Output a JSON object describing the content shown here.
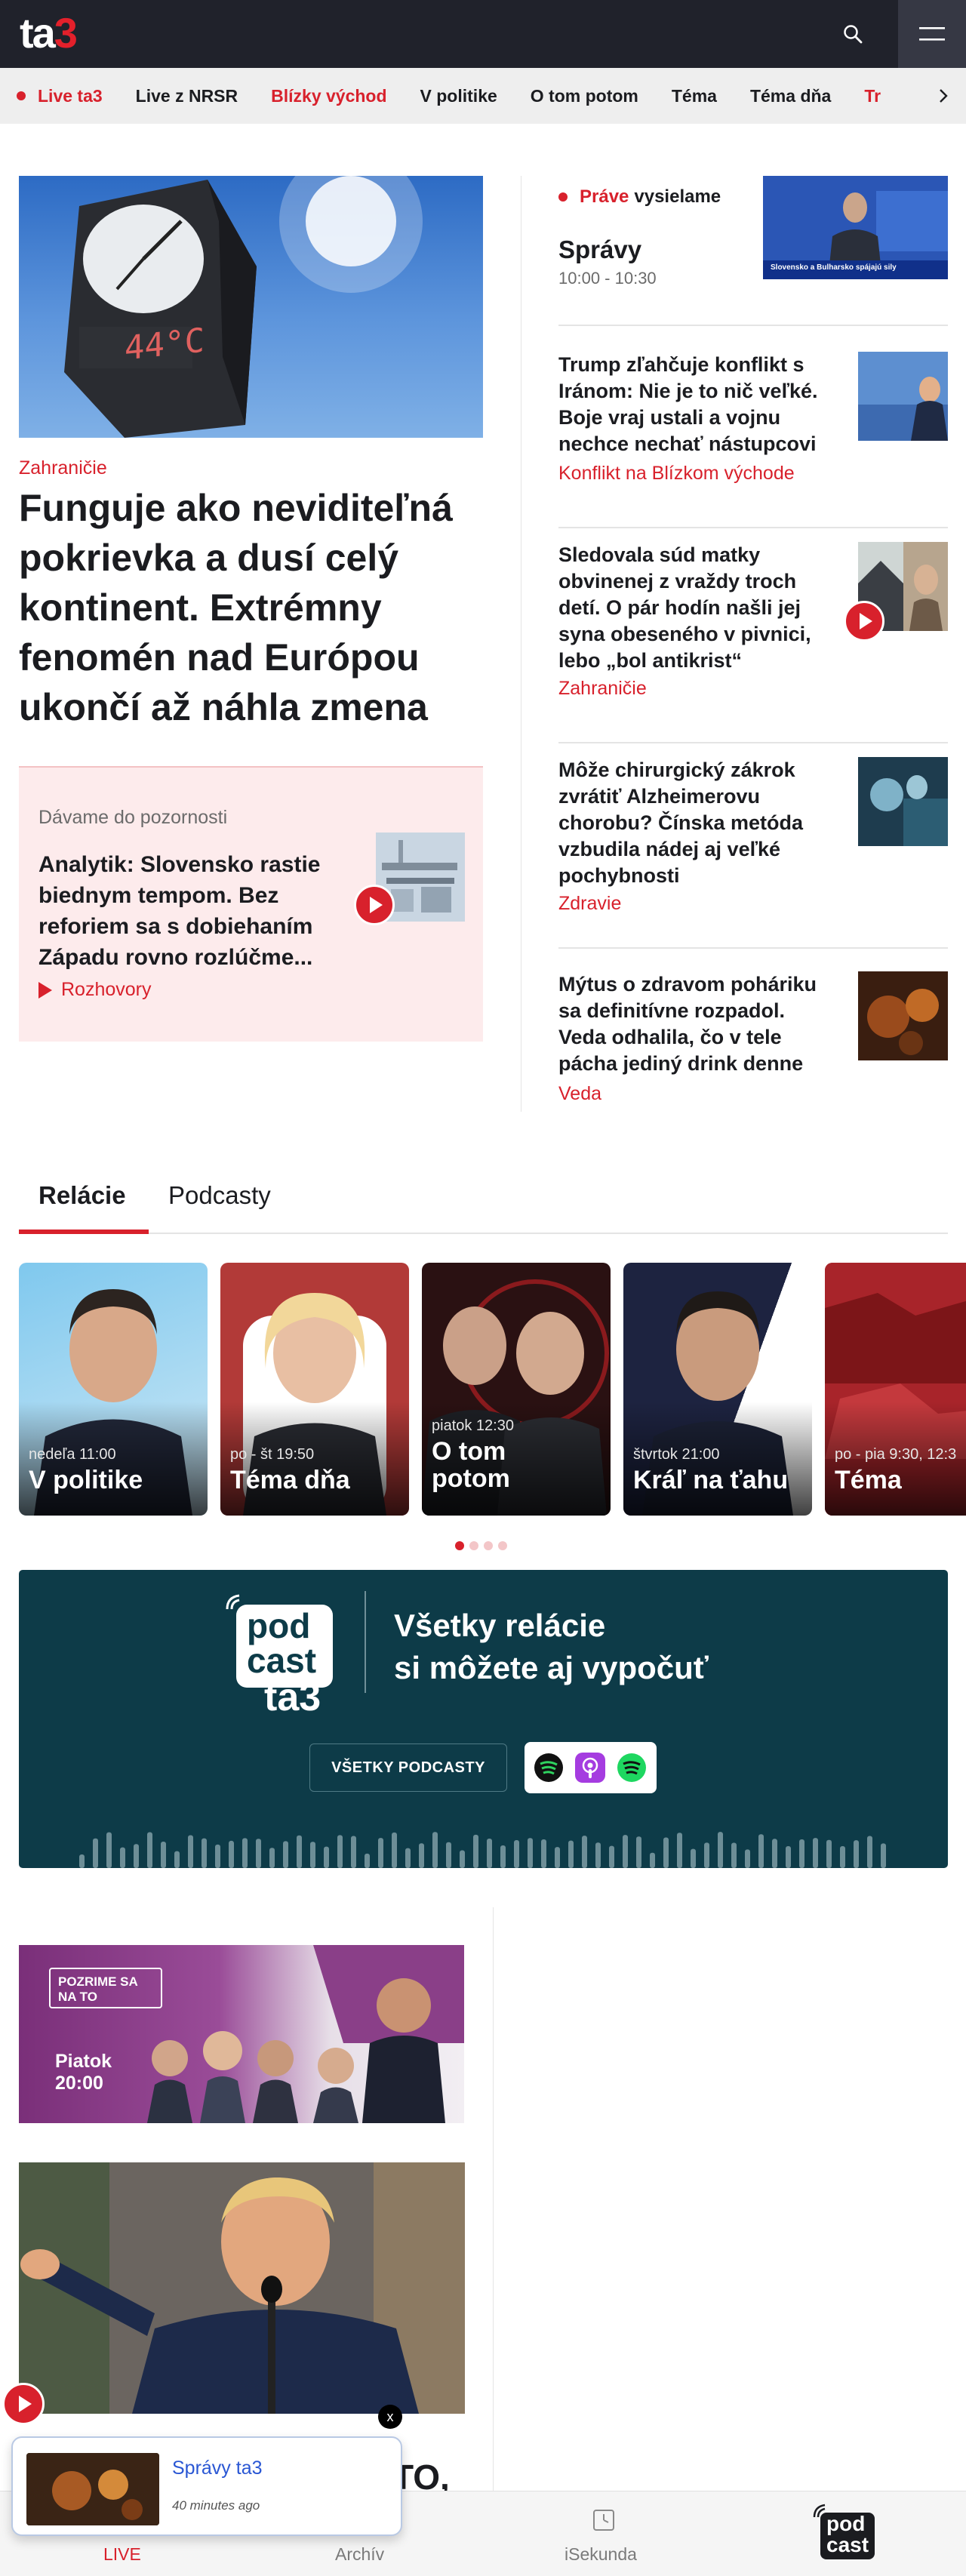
{
  "header": {
    "logo_ta": "ta",
    "logo_3": "3",
    "search_icon": "search-icon",
    "menu_icon": "hamburger-menu-icon"
  },
  "nav": {
    "items": [
      {
        "label": "Live ta3",
        "color": "#d8212c",
        "live": true
      },
      {
        "label": "Live z NRSR",
        "color": "#1b1c20"
      },
      {
        "label": "Blízky východ",
        "color": "#d8212c"
      },
      {
        "label": "V politike",
        "color": "#1b1c20"
      },
      {
        "label": "O tom potom",
        "color": "#1b1c20"
      },
      {
        "label": "Téma",
        "color": "#1b1c20"
      },
      {
        "label": "Téma dňa",
        "color": "#1b1c20"
      },
      {
        "label": "Tr",
        "color": "#d8212c"
      }
    ],
    "next_icon": "chevron-right-icon"
  },
  "hero": {
    "category": "Zahraničie",
    "title": "Funguje ako neviditeľná pokrievka a dusí celý kontinent. Extrémny fenomén nad Európou ukončí až náhla zmena",
    "image_text": "44°C"
  },
  "focus": {
    "label": "Dávame do pozornosti",
    "title": "Analytik: Slovensko rastie biednym tempom. Bez reforiem sa s dobiehaním Západu rovno rozlúčme...",
    "category": "Rozhovory"
  },
  "live": {
    "prefix": "Práve",
    "label": "vysielame",
    "show": "Správy",
    "time": "10:00 - 10:30",
    "thumb_caption": "Slovensko a Bulharsko spájajú sily"
  },
  "right_articles": [
    {
      "title": "Trump zľahčuje konflikt s Iránom: Nie je to nič veľké. Boje vraj ustali a vojnu nechce nechať nástupcovi",
      "category": "Konflikt na Blízkom východe"
    },
    {
      "title": "Sledovala súd matky obvinenej z vraždy troch detí. O pár hodín našli jej syna obeseného v pivnici, lebo „bol antikrist“",
      "category": "Zahraničie"
    },
    {
      "title": "Môže chirurgický zákrok zvrátiť Alzheimerovu chorobu? Čínska metóda vzbudila nádej aj veľké pochybnosti",
      "category": "Zdravie"
    },
    {
      "title": "Mýtus o zdravom poháriku sa definitívne rozpadol. Veda odhalila, čo v tele pácha jediný drink denne",
      "category": "Veda"
    }
  ],
  "tabs": {
    "active": "Relácie",
    "other": "Podcasty"
  },
  "shows": [
    {
      "schedule": "nedeľa 11:00",
      "name": "V politike"
    },
    {
      "schedule": "po - št 19:50",
      "name": "Téma dňa"
    },
    {
      "schedule": "piatok 12:30",
      "name": "O tom potom"
    },
    {
      "schedule": "štvrtok 21:00",
      "name": "Kráľ na ťahu"
    },
    {
      "schedule": "po - pia 9:30, 12:3",
      "name": "Téma"
    }
  ],
  "podcast": {
    "logo_line1": "pod",
    "logo_line2": "cast",
    "logo_line3": "ta3",
    "heading_line1": "Všetky relácie",
    "heading_line2": "si môžete aj vypočuť",
    "button": "VŠETKY PODCASTY",
    "apps": [
      "spotify-like-icon",
      "apple-podcasts-icon",
      "spotify-icon"
    ]
  },
  "promo": {
    "tag": "POZRIME SA NA TO",
    "when_line1": "Piatok",
    "when_line2": "20:00"
  },
  "cut_title": "TO,",
  "mini_player": {
    "title": "Správy ta3",
    "time": "40 minutes ago",
    "close": "x"
  },
  "bottom_nav": {
    "items": [
      "LIVE",
      "Archív",
      "iSekunda"
    ],
    "podcast_logo_line1": "pod",
    "podcast_logo_line2": "cast"
  },
  "colors": {
    "accent": "#d8212c",
    "header": "#20222b",
    "podcast_bg": "#0d3b48"
  }
}
